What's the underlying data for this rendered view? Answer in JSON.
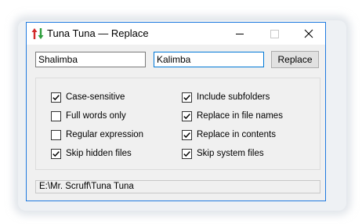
{
  "window": {
    "title": "Tuna Tuna — Replace",
    "controls": {
      "minimize": "minimize",
      "maximize": "maximize",
      "close": "close"
    }
  },
  "search": {
    "find_value": "Shalimba",
    "replace_value": "Kalimba",
    "replace_button": "Replace"
  },
  "options": [
    {
      "label": "Case-sensitive",
      "checked": true
    },
    {
      "label": "Full words only",
      "checked": false
    },
    {
      "label": "Regular expression",
      "checked": false
    },
    {
      "label": "Skip hidden files",
      "checked": true
    },
    {
      "label": "Include subfolders",
      "checked": true
    },
    {
      "label": "Replace in file names",
      "checked": true
    },
    {
      "label": "Replace in contents",
      "checked": true
    },
    {
      "label": "Skip system files",
      "checked": true
    }
  ],
  "status": {
    "path": "E:\\Mr. Scruff\\Tuna Tuna"
  },
  "icons": {
    "app": "up-down-arrows-icon"
  },
  "colors": {
    "accent": "#0078d7",
    "up_arrow": "#2e9e3e",
    "down_arrow": "#d22a2a"
  }
}
